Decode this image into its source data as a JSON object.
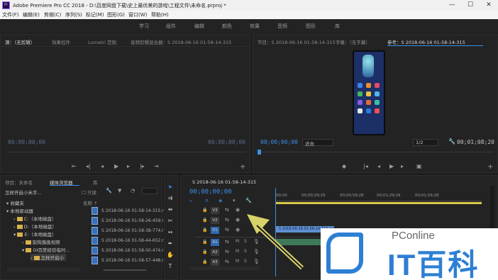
{
  "titlebar": {
    "title": "Adobe Premiere Pro CC 2018 - D:\\百度网盘下载\\史上最优美的游戏\\工程文件\\未命名.prproj *",
    "app_icon": "Pr",
    "minimize": "—",
    "maximize": "☐",
    "close": "✕"
  },
  "menu": [
    "文件(F)",
    "编辑(E)",
    "剪辑(C)",
    "序列(S)",
    "标记(M)",
    "图形(G)",
    "窗口(W)",
    "帮助(H)"
  ],
  "workspaces": [
    "学习",
    "组件",
    "编辑",
    "颜色",
    "效果",
    "音频",
    "图形",
    "库"
  ],
  "source_panel": {
    "tabs": [
      "源：（无剪辑）",
      "效果控件",
      "Lumetri 范围",
      "音频剪辑混合器：S 2018-06-16 01-58-14-315"
    ],
    "timecode_left": "00;00;00;00",
    "timecode_right": "00;00;00;00"
  },
  "program_panel": {
    "tabs": [
      "节目：S 2018-06-16 01-58-14-315",
      "字幕：（无字幕）",
      "参考：S 2018-06-16 01-58-14-315"
    ],
    "timecode": "00;00;00;00",
    "fit": "适合",
    "resolution": "1/2",
    "duration": "00;01;08;20"
  },
  "project_panel": {
    "tabs": [
      "项目：未命名",
      "媒体浏览器",
      "库"
    ],
    "search_path": "怎样开启小米手...",
    "readonly_label": "只读",
    "column_header": "名称 ↑",
    "tree": [
      {
        "label": "收藏夹",
        "indent": 0
      },
      {
        "label": "本地驱动器",
        "indent": 0
      },
      {
        "label": "C:（本地磁盘）",
        "indent": 1
      },
      {
        "label": "D:（本地磁盘）",
        "indent": 1
      },
      {
        "label": "E:（本地磁盘）",
        "indent": 1
      },
      {
        "label": "狼狗撸画视频",
        "indent": 2
      },
      {
        "label": "OI百度经验临时...",
        "indent": 2
      },
      {
        "label": "怎样开启小",
        "indent": 3
      }
    ],
    "files": [
      "S 2018-06-16 01-58-14-315.r",
      "S 2018-06-16 01-58-26-459.r",
      "S 2018-06-16 01-58-38-774.r",
      "S 2018-06-16 01-58-44-652.r",
      "S 2018-06-16 01-58-50-474.r",
      "S 2018-06-16 01-58-57-448.r"
    ]
  },
  "timeline": {
    "tab": "S 2018-06-16 01-58-14-315",
    "timecode": "00;00;00;00",
    "ruler": [
      "00;00",
      "00;00;29;29",
      "00;00;59;28",
      "00;01;29;29",
      "00;01;59;28"
    ],
    "video_tracks": [
      "V3",
      "V2",
      "V1"
    ],
    "audio_tracks": [
      "A1",
      "A2",
      "A3"
    ],
    "clip_label": "S 2018-06-16 01-58-14-315.mp4 [V]",
    "mute_label": "M",
    "solo_label": "S"
  },
  "watermark": {
    "brand": "PConline",
    "text": "IT百科"
  },
  "colors": {
    "accent": "#3b8eea",
    "timeline_clip": "#5f8fd0",
    "audio_clip": "#3e7a5a",
    "arrow": "#d7d26a"
  }
}
